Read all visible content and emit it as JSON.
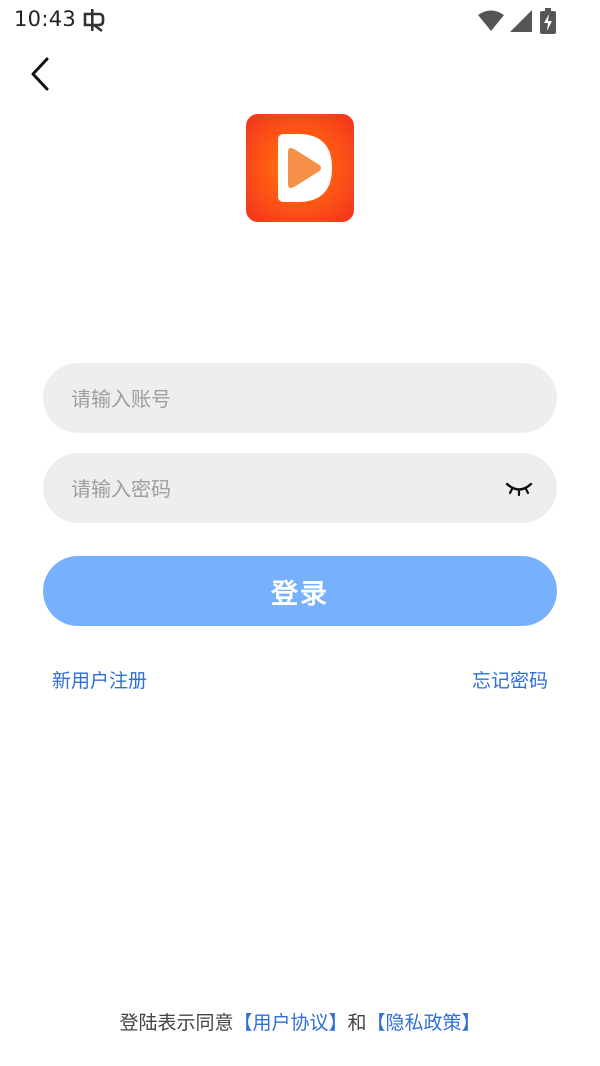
{
  "status_bar": {
    "time": "10:43",
    "icons": [
      "bug-icon",
      "wifi-icon",
      "signal-icon",
      "battery-charging-icon"
    ]
  },
  "nav": {
    "back_icon": "chevron-left-icon"
  },
  "logo": {
    "icon": "play-logo-icon",
    "colors": {
      "outer": "#f0321e",
      "inner": "#ff8a00",
      "play": "#f7914a"
    }
  },
  "form": {
    "account_placeholder": "请输入账号",
    "password_placeholder": "请输入密码",
    "eye_icon": "eye-closed-icon",
    "login_label": "登录",
    "login_color": "#77b1fd"
  },
  "links": {
    "register": "新用户注册",
    "forgot": "忘记密码",
    "color": "#2f6fd6"
  },
  "agreement": {
    "prefix": "登陆表示同意",
    "user_agreement": "【用户协议】",
    "conjunction": "和",
    "privacy_policy": "【隐私政策】"
  }
}
